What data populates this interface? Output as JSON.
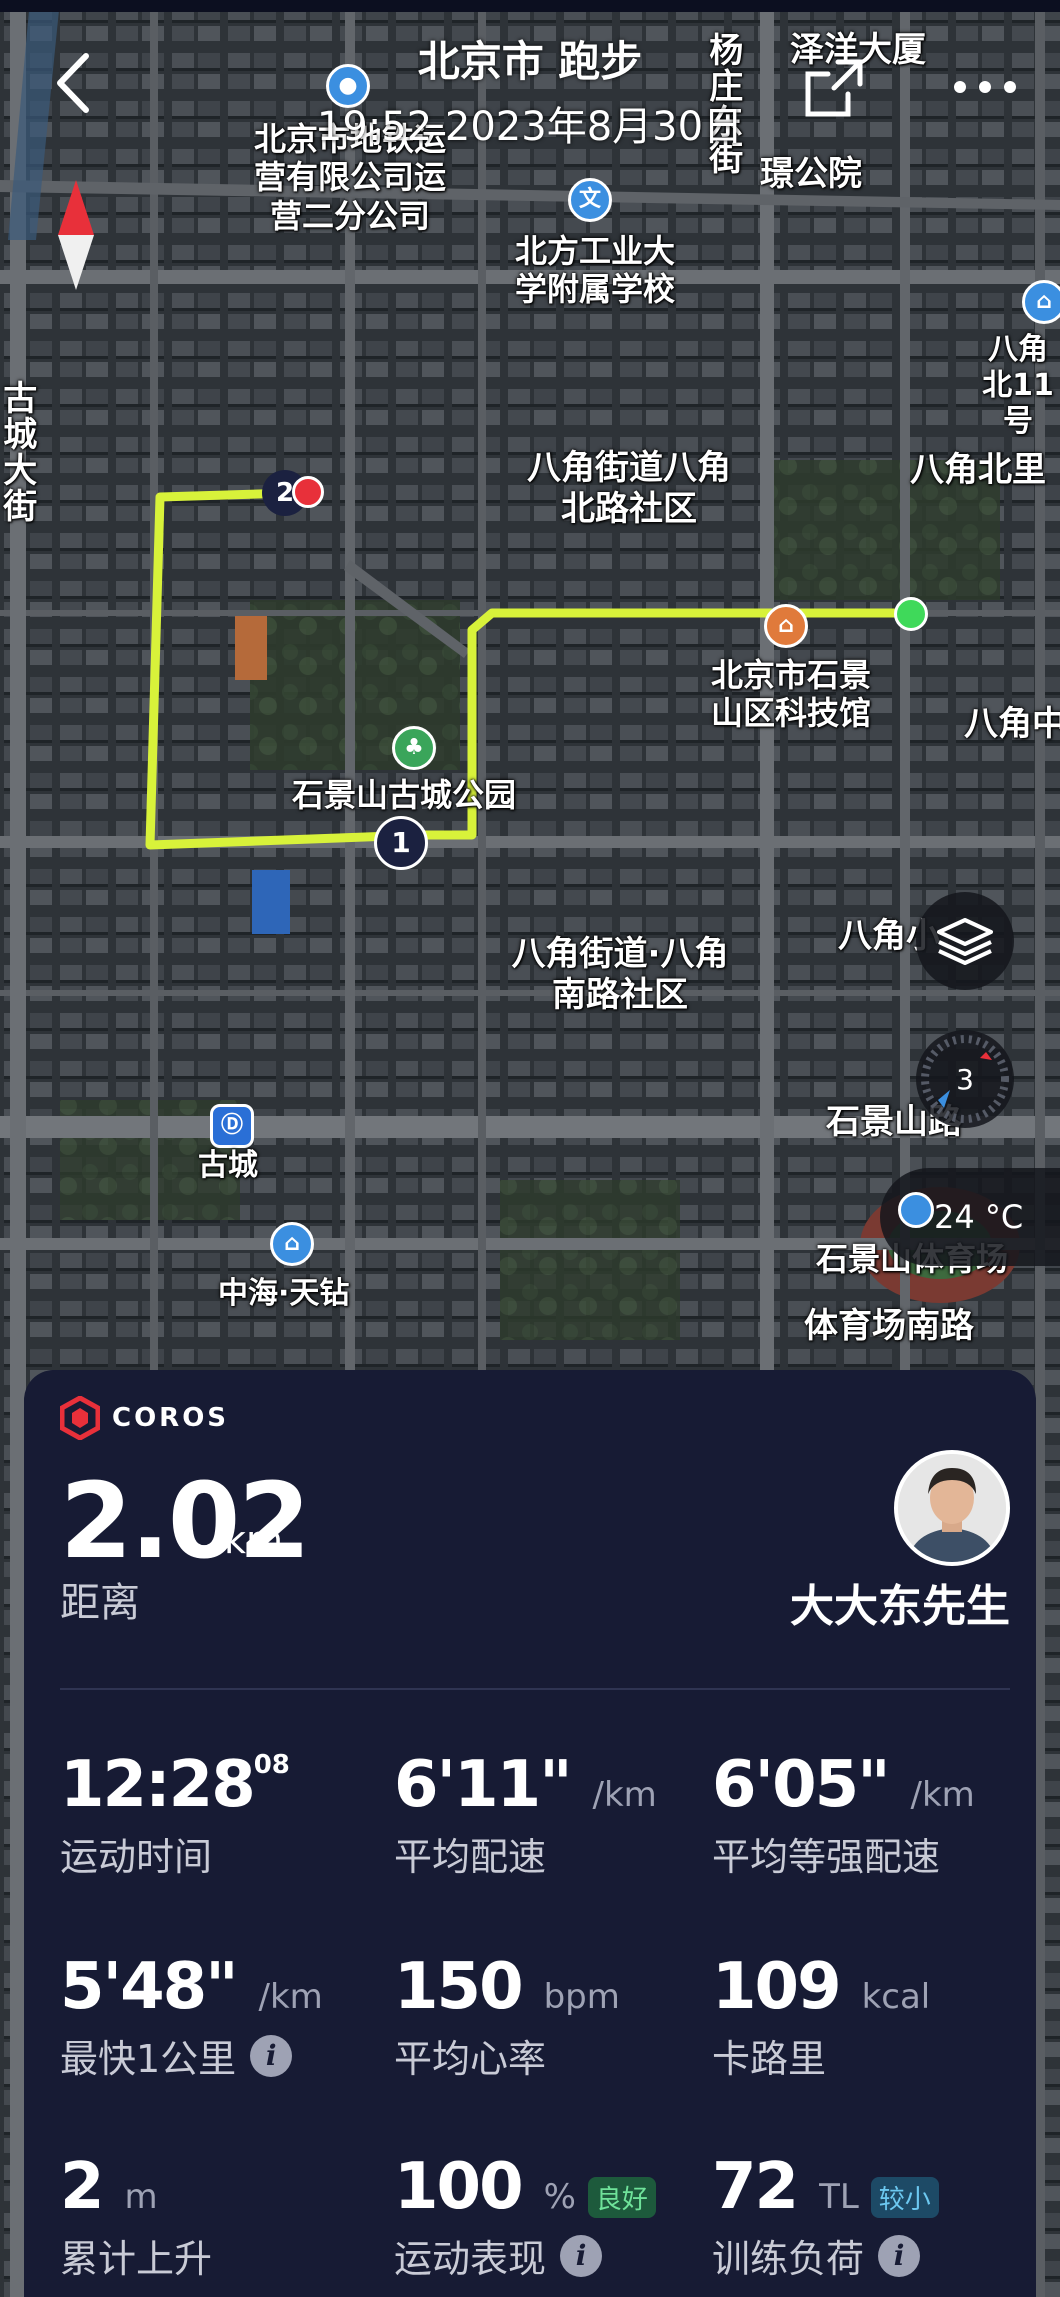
{
  "header": {
    "title": "北京市 跑步",
    "datetime": "19:52 2023年8月30日"
  },
  "map": {
    "labels": [
      "泽洋大厦",
      "杨庄东街",
      "璟公院",
      "北京市地铁运营有限公司运营二分公司",
      "北方工业大学附属学校",
      "八角北11号",
      "古城大街",
      "八角街道八角北路社区",
      "八角北里",
      "北京市石景山区科技馆",
      "八角中",
      "石景山古城公园",
      "八角街道·八角南路社区",
      "八角小",
      "石景山路",
      "古城",
      "中海·天钻",
      "石景山体育场",
      "体育场南路"
    ],
    "markers": {
      "lap1": "1",
      "lap2": "2"
    },
    "compass_value": "3",
    "weather_temp": "24 °C"
  },
  "card": {
    "brand": "COROS",
    "distance": {
      "value": "2.02",
      "unit": "km",
      "label": "距离"
    },
    "user": {
      "name": "大大东先生"
    },
    "stats": [
      {
        "value": "12:28",
        "sup": "08",
        "unit": "",
        "label": "运动时间",
        "badge": "",
        "info": false
      },
      {
        "value": "6'11\"",
        "sup": "",
        "unit": "/km",
        "label": "平均配速",
        "badge": "",
        "info": false
      },
      {
        "value": "6'05\"",
        "sup": "",
        "unit": "/km",
        "label": "平均等强配速",
        "badge": "",
        "info": false
      },
      {
        "value": "5'48\"",
        "sup": "",
        "unit": "/km",
        "label": "最快1公里",
        "badge": "",
        "info": true
      },
      {
        "value": "150",
        "sup": "",
        "unit": "bpm",
        "label": "平均心率",
        "badge": "",
        "info": false
      },
      {
        "value": "109",
        "sup": "",
        "unit": "kcal",
        "label": "卡路里",
        "badge": "",
        "info": false
      },
      {
        "value": "2",
        "sup": "",
        "unit": "m",
        "label": "累计上升",
        "badge": "",
        "info": false
      },
      {
        "value": "100",
        "sup": "",
        "unit": "%",
        "label": "运动表现",
        "badge": "良好",
        "info": true
      },
      {
        "value": "72",
        "sup": "",
        "unit": "TL",
        "label": "训练负荷",
        "badge": "较小",
        "info": true
      }
    ]
  },
  "colors": {
    "route": "#d8f23a",
    "card_bg": "#171b34",
    "start": "#3fd95a",
    "end": "#e8303a"
  }
}
